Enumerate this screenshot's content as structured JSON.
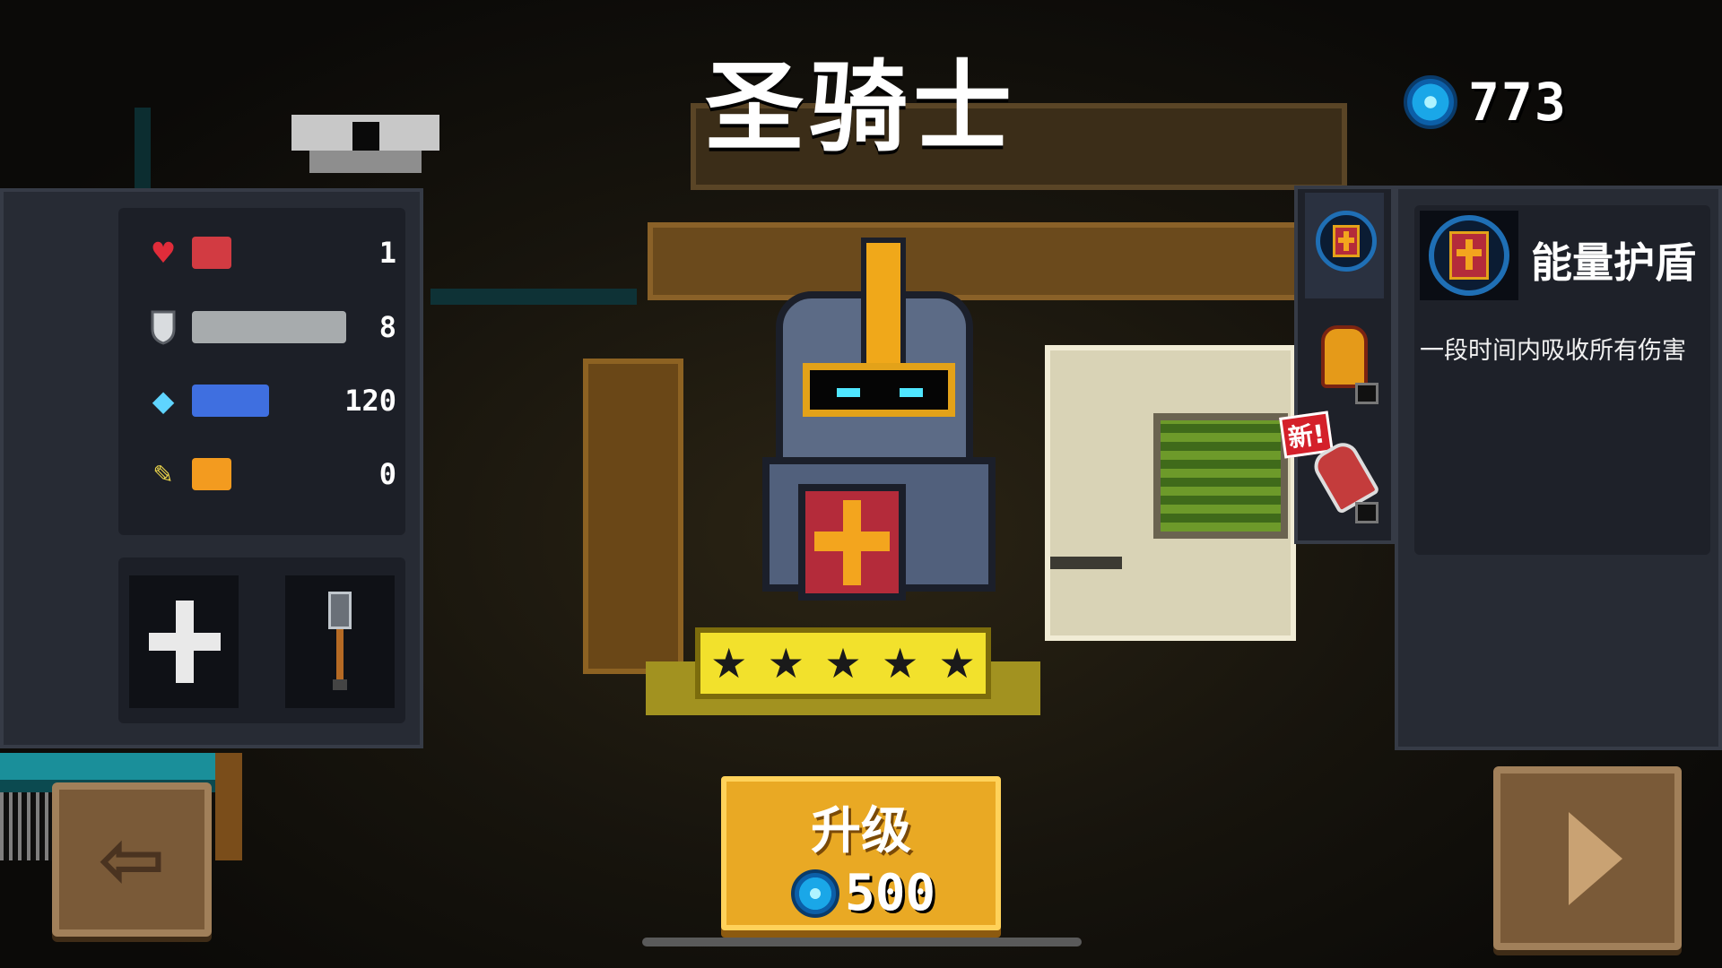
{
  "header": {
    "title": "圣骑士",
    "gem_count": "773"
  },
  "stats": {
    "items": [
      {
        "icon": "heart-icon",
        "value": "1",
        "fill": 0.2,
        "color": "#d23b42"
      },
      {
        "icon": "armor-icon",
        "value": "8",
        "fill": 1.0,
        "color": "#a7abad"
      },
      {
        "icon": "energy-icon",
        "value": "120",
        "fill": 0.5,
        "color": "#3f6fe0"
      },
      {
        "icon": "crit-icon",
        "value": "0",
        "fill": 0.2,
        "color": "#f39b1f"
      }
    ]
  },
  "loadout": {
    "slot1_icon": "plus-icon",
    "slot2_icon": "mace-icon"
  },
  "character": {
    "stars": "★★★★★",
    "star_count": 5
  },
  "skills": {
    "new_tag": "新!",
    "selected": {
      "name": "能量护盾",
      "description": "一段时间内吸收所有伤害"
    }
  },
  "actions": {
    "upgrade_label": "升级",
    "upgrade_cost": "500"
  },
  "colors": {
    "upgrade": "#e9a924",
    "panel": "#272b34",
    "gem": "#1aa7e8"
  }
}
